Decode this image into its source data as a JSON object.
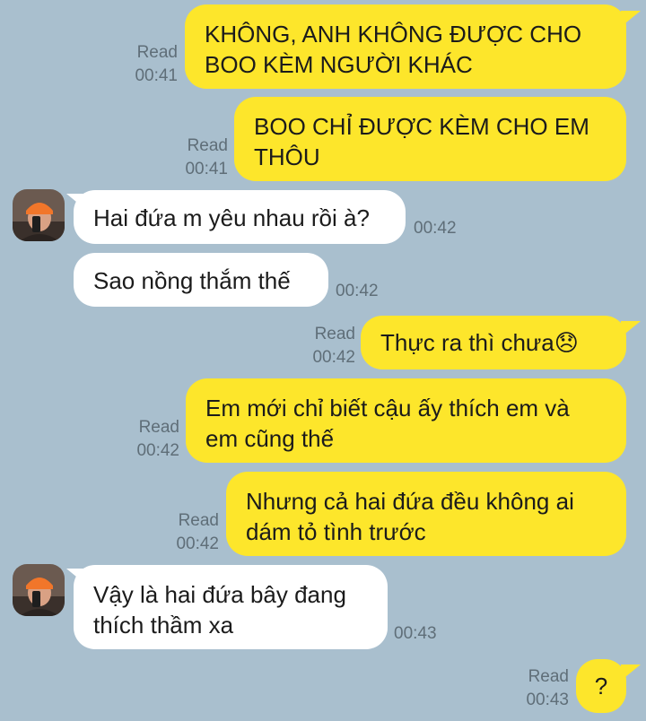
{
  "chat": {
    "messages": [
      {
        "side": "out",
        "text": "KHÔNG, ANH KHÔNG ĐƯỢC CHO BOO KÈM NGƯỜI KHÁC",
        "read": "Read",
        "time": "00:41"
      },
      {
        "side": "out",
        "text": "BOO CHỈ ĐƯỢC KÈM CHO EM THÔU",
        "read": "Read",
        "time": "00:41"
      },
      {
        "side": "in",
        "text": "Hai đứa m yêu nhau rồi à?",
        "time": "00:42"
      },
      {
        "side": "in",
        "text": "Sao nồng thắm thế",
        "time": "00:42"
      },
      {
        "side": "out",
        "text": "Thực ra thì chưa😞",
        "read": "Read",
        "time": "00:42"
      },
      {
        "side": "out",
        "text": "Em mới chỉ biết cậu ấy thích em và em cũng thế",
        "read": "Read",
        "time": "00:42"
      },
      {
        "side": "out",
        "text": "Nhưng cả hai đứa đều không ai dám tỏ tình trước",
        "read": "Read",
        "time": "00:42"
      },
      {
        "side": "in",
        "text": "Vậy là hai đứa bây đang thích thầm xa",
        "time": "00:43"
      },
      {
        "side": "out",
        "text": "?",
        "read": "Read",
        "time": "00:43"
      }
    ]
  },
  "colors": {
    "background": "#a9bfce",
    "outgoing_bubble": "#fde62b",
    "incoming_bubble": "#ffffff",
    "meta_text": "#5f6e78"
  },
  "icons": {
    "avatar": "user-avatar-orange-beanie"
  }
}
